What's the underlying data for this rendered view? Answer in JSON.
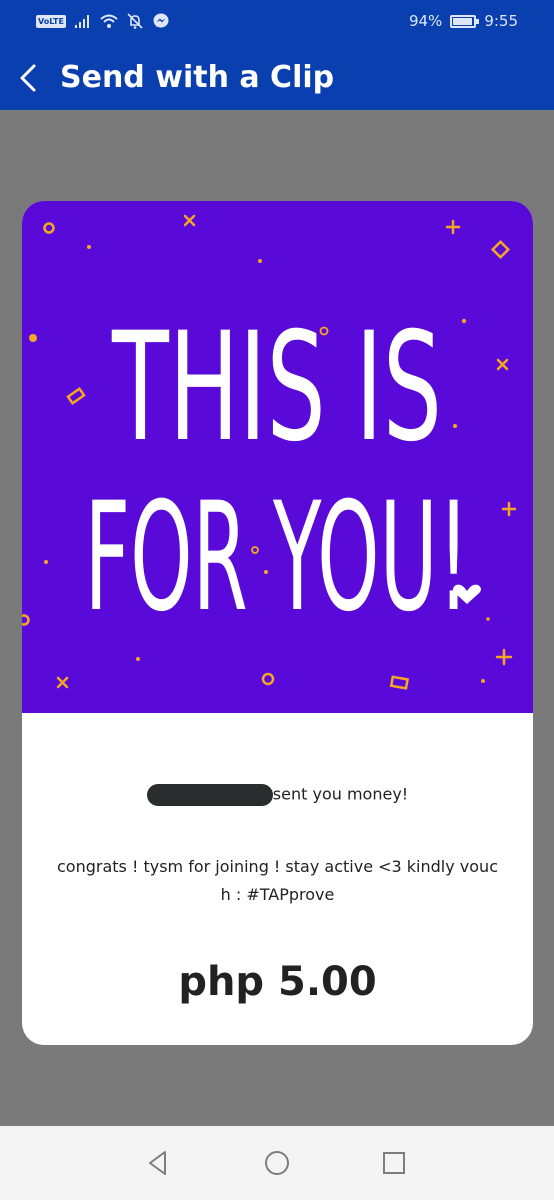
{
  "status_bar": {
    "volte": "VoLTE",
    "battery_percent": "94%",
    "battery_level": 0.94,
    "time": "9:55",
    "icons": [
      "signal-icon",
      "wifi-icon",
      "mute-icon",
      "messenger-icon",
      "battery-icon"
    ]
  },
  "app_bar": {
    "title": "Send with a Clip",
    "back_icon": "back-arrow-icon"
  },
  "clip": {
    "line1": "THIS IS",
    "line2": "FOR YOU!",
    "background": "#5a0ad8",
    "accent": "#f5a623"
  },
  "card": {
    "sender_text": "sent you money!",
    "message": "congrats ! tysm for joining ! stay active <3 kindly vouch : #TAPprove",
    "amount": "php 5.00"
  },
  "colors": {
    "brand_blue": "#0a3fb0",
    "overlay": "#7a7a7a"
  },
  "nav_bar": {
    "icons": [
      "back-triangle-icon",
      "home-circle-icon",
      "recents-square-icon"
    ]
  }
}
